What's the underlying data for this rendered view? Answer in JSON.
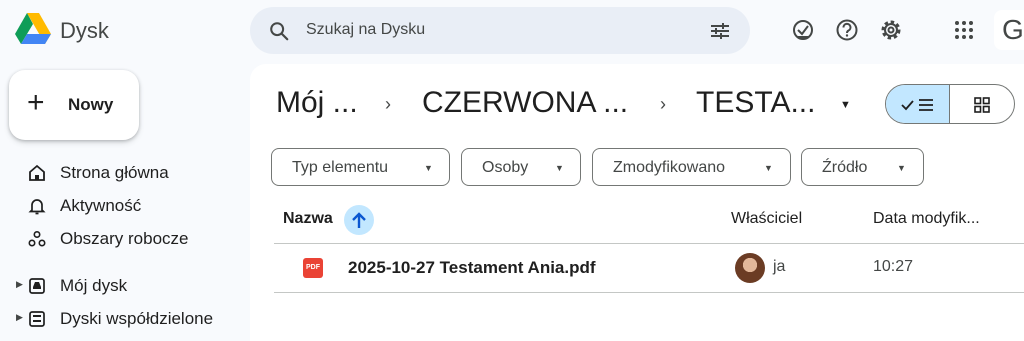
{
  "header": {
    "app_name": "Dysk",
    "search_placeholder": "Szukaj na Dysku",
    "account_initial": "G"
  },
  "sidebar": {
    "new_button": "Nowy",
    "items": [
      {
        "label": "Strona główna",
        "icon": "home-icon"
      },
      {
        "label": "Aktywność",
        "icon": "bell-icon"
      },
      {
        "label": "Obszary robocze",
        "icon": "workspaces-icon"
      },
      {
        "label": "Mój dysk",
        "icon": "drive-icon",
        "expandable": true
      },
      {
        "label": "Dyski współdzielone",
        "icon": "shared-drives-icon",
        "expandable": true
      }
    ]
  },
  "breadcrumb": [
    "Mój ...",
    "CZERWONA ...",
    "TESTA..."
  ],
  "filters": [
    "Typ elementu",
    "Osoby",
    "Zmodyfikowano",
    "Źródło"
  ],
  "table": {
    "columns": {
      "name": "Nazwa",
      "owner": "Właściciel",
      "modified": "Data modyfik..."
    },
    "rows": [
      {
        "icon_text": "PDF",
        "name": "2025-10-27 Testament Ania.pdf",
        "owner": "ja",
        "modified": "10:27"
      }
    ]
  },
  "colors": {
    "accent": "#c2e7ff",
    "background": "#f8fafd",
    "pdf": "#ea4335"
  }
}
